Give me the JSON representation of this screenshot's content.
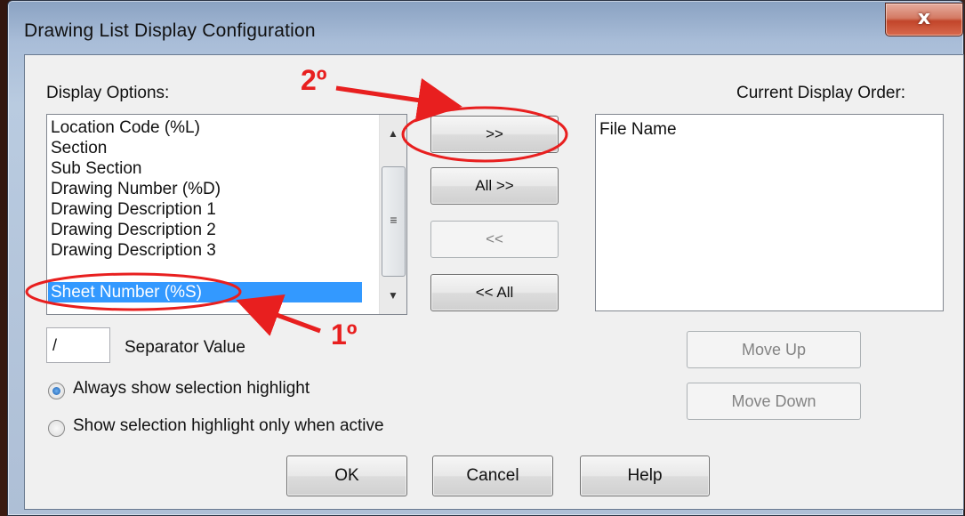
{
  "window": {
    "title": "Drawing List Display Configuration",
    "close_glyph": "x"
  },
  "display_options": {
    "label": "Display Options:",
    "items": [
      "Location Code (%L)",
      "Section",
      "Sub Section",
      "Drawing Number (%D)",
      "Drawing Description 1",
      "Drawing Description 2",
      "Drawing Description 3",
      "Sheet Number (%S)"
    ],
    "selected_index": 7
  },
  "current_order": {
    "label": "Current Display Order:",
    "items": [
      "File Name"
    ]
  },
  "buttons": {
    "add": ">>",
    "add_all": "All >>",
    "remove": "<<",
    "remove_all": "<< All",
    "move_up": "Move Up",
    "move_down": "Move Down",
    "ok": "OK",
    "cancel": "Cancel",
    "help": "Help"
  },
  "separator": {
    "value": "/",
    "label": "Separator Value"
  },
  "radios": {
    "always": "Always show selection highlight",
    "active_only": "Show selection highlight only when active",
    "selected": "always"
  },
  "annotations": {
    "step1": "1º",
    "step2": "2º",
    "color": "#e81f1f"
  }
}
